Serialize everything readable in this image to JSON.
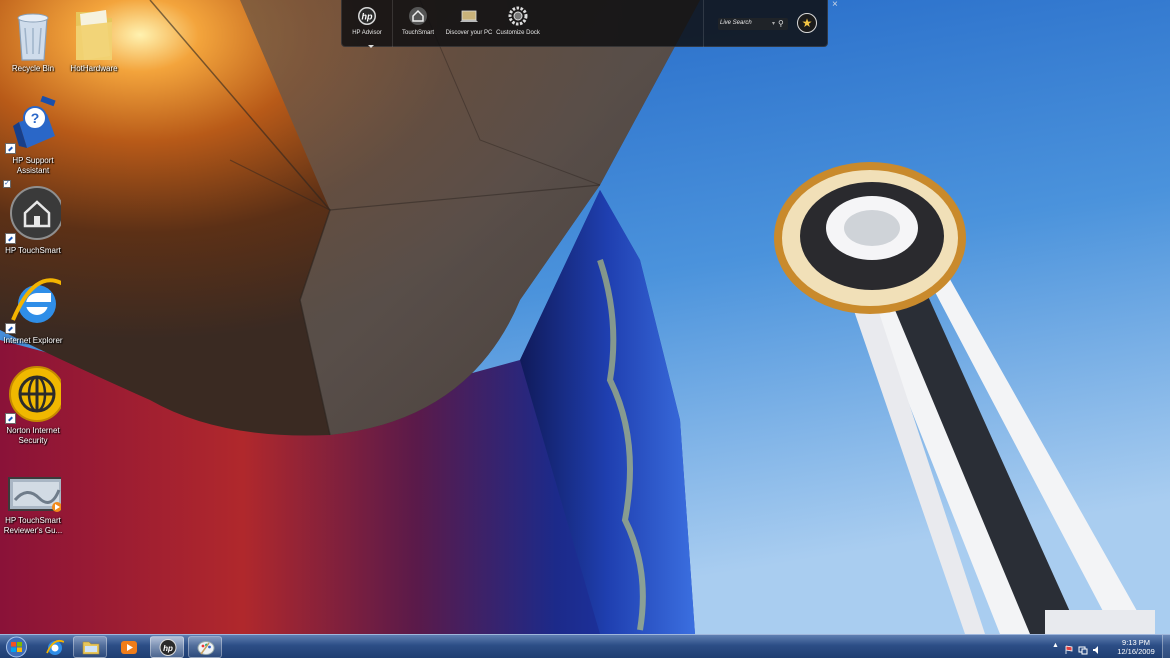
{
  "desktop": {
    "icons": [
      {
        "label": "Recycle Bin",
        "icon": "recycle-bin-icon"
      },
      {
        "label": "HotHardware",
        "icon": "folder-icon"
      },
      {
        "label": "HP Support Assistant",
        "icon": "hp-support-assistant-icon"
      },
      {
        "label": "HP TouchSmart",
        "icon": "hp-touchsmart-icon"
      },
      {
        "label": "Internet Explorer",
        "icon": "internet-explorer-icon"
      },
      {
        "label": "Norton Internet Security",
        "icon": "norton-icon"
      },
      {
        "label": "HP TouchSmart Reviewer's Gu...",
        "icon": "video-file-icon"
      }
    ]
  },
  "dock": {
    "items": [
      {
        "label": "HP Advisor",
        "icon": "hp-logo-icon"
      },
      {
        "label": "TouchSmart",
        "icon": "house-icon"
      },
      {
        "label": "Discover your PC",
        "icon": "laptop-icon"
      },
      {
        "label": "Customize Dock",
        "icon": "gear-icon"
      }
    ],
    "search_placeholder": "Live Search",
    "favorites_icon": "star-icon"
  },
  "taskbar": {
    "start_icon": "windows-logo-icon",
    "pinned": [
      {
        "name": "internet-explorer",
        "icon": "internet-explorer-icon"
      },
      {
        "name": "windows-explorer",
        "icon": "folder-icon"
      },
      {
        "name": "media-player",
        "icon": "media-player-icon"
      },
      {
        "name": "hp-advisor",
        "icon": "hp-logo-icon"
      },
      {
        "name": "paint",
        "icon": "paint-icon"
      }
    ],
    "clock": {
      "time": "9:13 PM",
      "date": "12/16/2009"
    }
  },
  "colors": {
    "sky": "#3d86d8",
    "taskbar": "#2c4e86",
    "dock_bg": "#0f0f12"
  }
}
